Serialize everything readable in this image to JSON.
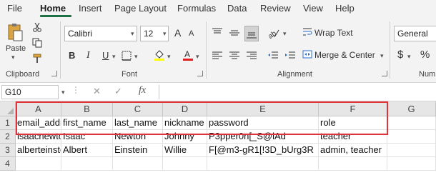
{
  "tabs": [
    "File",
    "Home",
    "Insert",
    "Page Layout",
    "Formulas",
    "Data",
    "Review",
    "View",
    "Help"
  ],
  "ribbon": {
    "clipboard": {
      "paste_label": "Paste",
      "group_label": "Clipboard"
    },
    "font": {
      "font_name": "Calibri",
      "font_size": "12",
      "grow": "A",
      "shrink": "A",
      "bold": "B",
      "italic": "I",
      "underline": "U",
      "group_label": "Font"
    },
    "alignment": {
      "wrap_text": "Wrap Text",
      "merge_center": "Merge & Center",
      "group_label": "Alignment"
    },
    "number": {
      "format": "General",
      "currency": "$",
      "percent": "%",
      "group_label": "Num"
    }
  },
  "formula_bar": {
    "name_box": "G10",
    "fx": "fx",
    "cancel": "✕",
    "enter": "✓",
    "value": ""
  },
  "grid": {
    "columns": [
      "A",
      "B",
      "C",
      "D",
      "E",
      "F",
      "G"
    ],
    "row_numbers": [
      "1",
      "2",
      "3",
      "4"
    ],
    "rows": [
      [
        "email_address",
        "first_name",
        "last_name",
        "nickname",
        "password",
        "role"
      ],
      [
        "isaacnewton",
        "Isaac",
        "Newton",
        "Johnny",
        "P3pper0n[_S@lAd",
        "teacher"
      ],
      [
        "alberteinstein",
        "Albert",
        "Einstein",
        "Willie",
        "F[@m3-gR1[!3D_bUrg3R",
        "admin, teacher"
      ]
    ]
  },
  "colors": {
    "accent": "#1e7145",
    "highlight_border": "#e0343a",
    "font_color_bar": "#e02020",
    "fill_color_bar": "#ffff00"
  }
}
